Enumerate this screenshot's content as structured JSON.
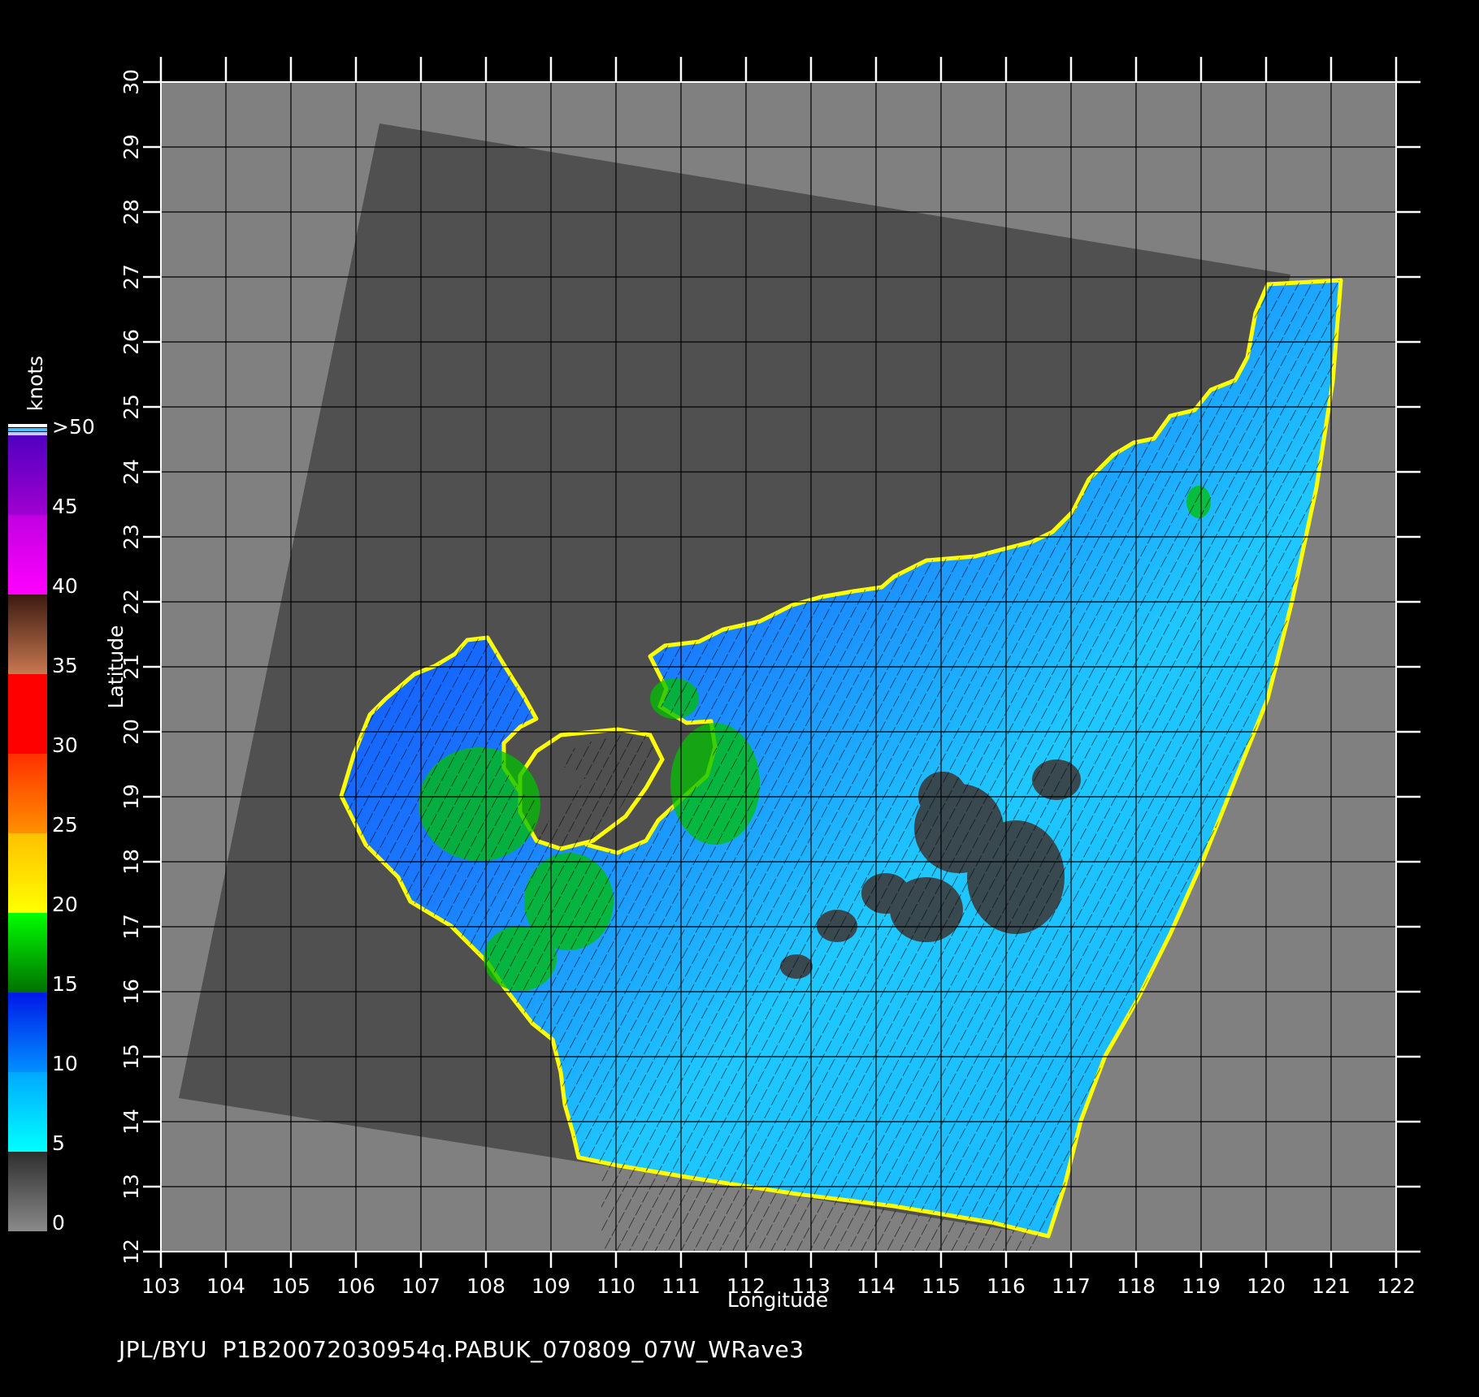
{
  "map": {
    "x_label": "Longitude",
    "y_label": "Latitude",
    "lon_ticks": [
      "103",
      "104",
      "105",
      "106",
      "107",
      "108",
      "109",
      "110",
      "111",
      "112",
      "113",
      "114",
      "115",
      "116",
      "117",
      "118",
      "119",
      "120",
      "121",
      "122"
    ],
    "lat_ticks": [
      "12",
      "13",
      "14",
      "15",
      "16",
      "17",
      "18",
      "19",
      "20",
      "21",
      "22",
      "23",
      "24",
      "25",
      "26",
      "27",
      "28",
      "29",
      "30"
    ],
    "lon_range": [
      103,
      122
    ],
    "lat_range": [
      12,
      30
    ],
    "background_color": "#808080",
    "swath_color": "#505050",
    "land_color": "#7f7f7f"
  },
  "colorbar": {
    "unit_label": "knots",
    "labels": [
      ">50",
      "45",
      "40",
      "35",
      "30",
      "25",
      "20",
      "15",
      "10",
      "5",
      "0"
    ],
    "segments": [
      {
        "from": 0,
        "to": 5,
        "colors": [
          "#8a8a8a",
          "#2e2e2e"
        ]
      },
      {
        "from": 5,
        "to": 10,
        "colors": [
          "#00ffff",
          "#00a8ff"
        ]
      },
      {
        "from": 10,
        "to": 15,
        "colors": [
          "#0090ff",
          "#0018e8"
        ]
      },
      {
        "from": 15,
        "to": 20,
        "colors": [
          "#007000",
          "#00ff00"
        ]
      },
      {
        "from": 20,
        "to": 25,
        "colors": [
          "#ffff00",
          "#ffc000"
        ]
      },
      {
        "from": 25,
        "to": 30,
        "colors": [
          "#ff9000",
          "#ff3000"
        ]
      },
      {
        "from": 30,
        "to": 35,
        "colors": [
          "#ff0000",
          "#ff0000"
        ]
      },
      {
        "from": 35,
        "to": 40,
        "colors": [
          "#c87850",
          "#3c1a10"
        ]
      },
      {
        "from": 40,
        "to": 45,
        "colors": [
          "#ff00ff",
          "#c000e0"
        ]
      },
      {
        "from": 45,
        "to": 50,
        "colors": [
          "#a000d0",
          "#5000c0"
        ]
      }
    ]
  },
  "footer": {
    "text": "JPL/BYU  P1B20072030954q.PABUK_070809_07W_WRave3"
  }
}
